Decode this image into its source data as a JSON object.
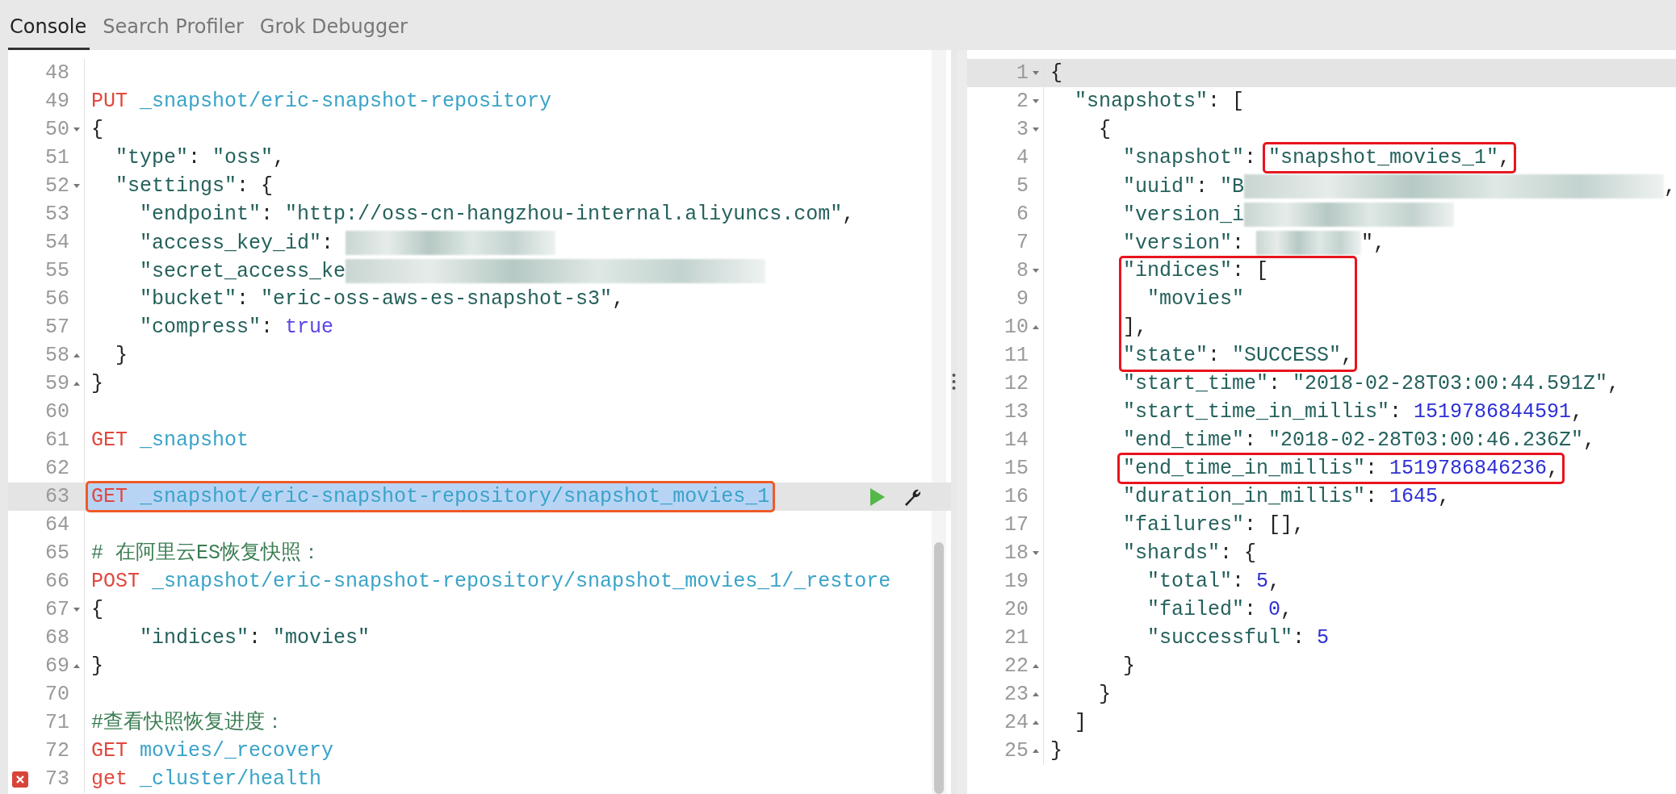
{
  "tabs": [
    {
      "label": "Console",
      "selected": true
    },
    {
      "label": "Search Profiler",
      "selected": false
    },
    {
      "label": "Grok Debugger",
      "selected": false
    }
  ],
  "request_editor": {
    "lines": [
      {
        "number": "48",
        "kind": "plain",
        "current": false,
        "selected": false,
        "error": false
      },
      {
        "number": "49",
        "kind": "plain",
        "current": false,
        "selected": false,
        "error": false,
        "tokens": [
          {
            "text": "PUT",
            "kind": "method"
          },
          {
            "text": " _snapshot/eric-snapshot-repository",
            "kind": "path"
          }
        ]
      },
      {
        "number": "50",
        "kind": "foldstart",
        "current": false,
        "selected": false,
        "error": false,
        "tokens": [
          {
            "text": "{",
            "kind": "punct"
          }
        ]
      },
      {
        "number": "51",
        "kind": "plain",
        "current": false,
        "selected": false,
        "error": false,
        "tokens": [
          {
            "text": "  \"type\"",
            "kind": "key"
          },
          {
            "text": ": ",
            "kind": "punct"
          },
          {
            "text": "\"oss\"",
            "kind": "string"
          },
          {
            "text": ",",
            "kind": "punct"
          }
        ]
      },
      {
        "number": "52",
        "kind": "foldstart",
        "current": false,
        "selected": false,
        "error": false,
        "tokens": [
          {
            "text": "  \"settings\"",
            "kind": "key"
          },
          {
            "text": ": {",
            "kind": "punct"
          }
        ]
      },
      {
        "number": "53",
        "kind": "plain",
        "current": false,
        "selected": false,
        "error": false,
        "tokens": [
          {
            "text": "    \"endpoint\"",
            "kind": "key"
          },
          {
            "text": ": ",
            "kind": "punct"
          },
          {
            "text": "\"http://oss-cn-hangzhou-internal.aliyuncs.com\"",
            "kind": "string"
          },
          {
            "text": ",",
            "kind": "punct"
          }
        ]
      },
      {
        "number": "54",
        "kind": "plain",
        "current": false,
        "selected": false,
        "error": false,
        "tokens": [
          {
            "text": "    \"access_key_id\"",
            "kind": "key"
          },
          {
            "text": ": ",
            "kind": "punct"
          },
          {
            "kind": "blurmedium"
          }
        ]
      },
      {
        "number": "55",
        "kind": "plain",
        "current": false,
        "selected": false,
        "error": false,
        "tokens": [
          {
            "text": "    \"secret_access_ke",
            "kind": "key"
          },
          {
            "kind": "blurlong"
          }
        ]
      },
      {
        "number": "56",
        "kind": "plain",
        "current": false,
        "selected": false,
        "error": false,
        "tokens": [
          {
            "text": "    \"bucket\"",
            "kind": "key"
          },
          {
            "text": ": ",
            "kind": "punct"
          },
          {
            "text": "\"eric-oss-aws-es-snapshot-s3\"",
            "kind": "string"
          },
          {
            "text": ",",
            "kind": "punct"
          }
        ]
      },
      {
        "number": "57",
        "kind": "plain",
        "current": false,
        "selected": false,
        "error": false,
        "tokens": [
          {
            "text": "    \"compress\"",
            "kind": "key"
          },
          {
            "text": ": ",
            "kind": "punct"
          },
          {
            "text": "true",
            "kind": "bool"
          }
        ]
      },
      {
        "number": "58",
        "kind": "foldend",
        "current": false,
        "selected": false,
        "error": false,
        "tokens": [
          {
            "text": "  }",
            "kind": "punct"
          }
        ]
      },
      {
        "number": "59",
        "kind": "foldend",
        "current": false,
        "selected": false,
        "error": false,
        "tokens": [
          {
            "text": "}",
            "kind": "punct"
          }
        ]
      },
      {
        "number": "60",
        "kind": "plain",
        "current": false,
        "selected": false,
        "error": false
      },
      {
        "number": "61",
        "kind": "plain",
        "current": false,
        "selected": false,
        "error": false,
        "tokens": [
          {
            "text": "GET",
            "kind": "method"
          },
          {
            "text": " _snapshot",
            "kind": "path"
          }
        ]
      },
      {
        "number": "62",
        "kind": "plain",
        "current": false,
        "selected": false,
        "error": false
      },
      {
        "number": "63",
        "kind": "plain",
        "current": true,
        "selected": true,
        "error": false,
        "boxed_tokens": [
          {
            "text": "GET",
            "kind": "method"
          },
          {
            "text": " _snapshot/eric-snapshot-repository/snapshot_movies_1",
            "kind": "path"
          }
        ]
      },
      {
        "number": "64",
        "kind": "plain",
        "current": false,
        "selected": false,
        "error": false
      },
      {
        "number": "65",
        "kind": "plain",
        "current": false,
        "selected": false,
        "error": false,
        "tokens": [
          {
            "text": "# 在阿里云ES恢复快照：",
            "kind": "comment"
          }
        ]
      },
      {
        "number": "66",
        "kind": "plain",
        "current": false,
        "selected": false,
        "error": false,
        "tokens": [
          {
            "text": "POST",
            "kind": "method"
          },
          {
            "text": " _snapshot/eric-snapshot-repository/snapshot_movies_1/_restore",
            "kind": "path"
          }
        ]
      },
      {
        "number": "67",
        "kind": "foldstart",
        "current": false,
        "selected": false,
        "error": false,
        "tokens": [
          {
            "text": "{",
            "kind": "punct"
          }
        ]
      },
      {
        "number": "68",
        "kind": "plain",
        "current": false,
        "selected": false,
        "error": false,
        "tokens": [
          {
            "text": "    \"indices\"",
            "kind": "key"
          },
          {
            "text": ": ",
            "kind": "punct"
          },
          {
            "text": "\"movies\"",
            "kind": "string"
          }
        ]
      },
      {
        "number": "69",
        "kind": "foldend",
        "current": false,
        "selected": false,
        "error": false,
        "tokens": [
          {
            "text": "}",
            "kind": "punct"
          }
        ]
      },
      {
        "number": "70",
        "kind": "plain",
        "current": false,
        "selected": false,
        "error": false
      },
      {
        "number": "71",
        "kind": "plain",
        "current": false,
        "selected": false,
        "error": false,
        "tokens": [
          {
            "text": "#查看快照恢复进度：",
            "kind": "comment"
          }
        ]
      },
      {
        "number": "72",
        "kind": "plain",
        "current": false,
        "selected": false,
        "error": false,
        "tokens": [
          {
            "text": "GET",
            "kind": "method"
          },
          {
            "text": " movies/_recovery",
            "kind": "path"
          }
        ]
      },
      {
        "number": "73",
        "kind": "plain",
        "current": false,
        "selected": false,
        "error": true,
        "tokens": [
          {
            "text": "get",
            "kind": "method"
          },
          {
            "text": " _cluster/health",
            "kind": "path"
          }
        ]
      }
    ]
  },
  "response_viewer": {
    "lines": [
      {
        "number": "1",
        "kind": "foldstart",
        "current": true,
        "selected": false,
        "error": false,
        "tokens": [
          {
            "text": "{",
            "kind": "punct"
          }
        ]
      },
      {
        "number": "2",
        "kind": "foldstart",
        "current": false,
        "selected": false,
        "error": false,
        "tokens": [
          {
            "text": "  \"snapshots\"",
            "kind": "key"
          },
          {
            "text": ": [",
            "kind": "punct"
          }
        ]
      },
      {
        "number": "3",
        "kind": "foldstart",
        "current": false,
        "selected": false,
        "error": false,
        "tokens": [
          {
            "text": "    {",
            "kind": "punct"
          }
        ]
      },
      {
        "number": "4",
        "kind": "plain",
        "current": false,
        "selected": false,
        "error": false,
        "tokens": [
          {
            "text": "      \"snapshot\"",
            "kind": "key"
          },
          {
            "text": ": ",
            "kind": "punct"
          }
        ],
        "boxed_tokens": [
          {
            "text": "\"snapshot_movies_1\"",
            "kind": "string"
          },
          {
            "text": ",",
            "kind": "punct"
          }
        ]
      },
      {
        "number": "5",
        "kind": "plain",
        "current": false,
        "selected": false,
        "error": false,
        "tokens": [
          {
            "text": "      \"uuid\"",
            "kind": "key"
          },
          {
            "text": ": ",
            "kind": "punct"
          },
          {
            "text": "\"B",
            "kind": "string"
          },
          {
            "kind": "blurlong"
          },
          {
            "text": ",",
            "kind": "punct"
          }
        ]
      },
      {
        "number": "6",
        "kind": "plain",
        "current": false,
        "selected": false,
        "error": false,
        "tokens": [
          {
            "text": "      \"version_i",
            "kind": "key"
          },
          {
            "kind": "blurmedium"
          }
        ]
      },
      {
        "number": "7",
        "kind": "plain",
        "current": false,
        "selected": false,
        "error": false,
        "tokens": [
          {
            "text": "      \"version\"",
            "kind": "key"
          },
          {
            "text": ": ",
            "kind": "punct"
          },
          {
            "kind": "blurshort"
          },
          {
            "text": "\",",
            "kind": "punct"
          }
        ]
      },
      {
        "number": "8",
        "kind": "foldstart",
        "current": false,
        "selected": false,
        "error": false,
        "boxed_tokens": [
          {
            "text": "      \"indices\"",
            "kind": "key"
          },
          {
            "text": ": [",
            "kind": "punct"
          }
        ]
      },
      {
        "number": "9",
        "kind": "plain",
        "current": false,
        "selected": false,
        "error": false,
        "boxed_tokens": [
          {
            "text": "        \"movies\"",
            "kind": "string"
          }
        ]
      },
      {
        "number": "10",
        "kind": "foldend",
        "current": false,
        "selected": false,
        "error": false,
        "boxed_tokens": [
          {
            "text": "      ],",
            "kind": "punct"
          }
        ]
      },
      {
        "number": "11",
        "kind": "plain",
        "current": false,
        "selected": false,
        "error": false,
        "boxed_tokens": [
          {
            "text": "      \"state\"",
            "kind": "key"
          },
          {
            "text": ": ",
            "kind": "punct"
          },
          {
            "text": "\"SUCCESS\"",
            "kind": "string"
          },
          {
            "text": ",",
            "kind": "punct"
          }
        ]
      },
      {
        "number": "12",
        "kind": "plain",
        "current": false,
        "selected": false,
        "error": false,
        "tokens": [
          {
            "text": "      \"start_time\"",
            "kind": "key"
          },
          {
            "text": ": ",
            "kind": "punct"
          },
          {
            "text": "\"2018-02-28T03:00:44.591Z\"",
            "kind": "string"
          },
          {
            "text": ",",
            "kind": "punct"
          }
        ]
      },
      {
        "number": "13",
        "kind": "plain",
        "current": false,
        "selected": false,
        "error": false,
        "tokens": [
          {
            "text": "      \"start_time_in_millis\"",
            "kind": "key"
          },
          {
            "text": ": ",
            "kind": "punct"
          },
          {
            "text": "1519786844591",
            "kind": "number"
          },
          {
            "text": ",",
            "kind": "punct"
          }
        ]
      },
      {
        "number": "14",
        "kind": "plain",
        "current": false,
        "selected": false,
        "error": false,
        "tokens": [
          {
            "text": "      \"end_time\"",
            "kind": "key"
          },
          {
            "text": ": ",
            "kind": "punct"
          },
          {
            "text": "\"2018-02-28T03:00:46.236Z\"",
            "kind": "string"
          },
          {
            "text": ",",
            "kind": "punct"
          }
        ]
      },
      {
        "number": "15",
        "kind": "plain",
        "current": false,
        "selected": false,
        "error": false,
        "boxed_tokens": [
          {
            "text": "      \"end_time_in_millis\"",
            "kind": "key"
          },
          {
            "text": ": ",
            "kind": "punct"
          },
          {
            "text": "1519786846236",
            "kind": "number"
          },
          {
            "text": ",",
            "kind": "punct"
          }
        ]
      },
      {
        "number": "16",
        "kind": "plain",
        "current": false,
        "selected": false,
        "error": false,
        "tokens": [
          {
            "text": "      \"duration_in_millis\"",
            "kind": "key"
          },
          {
            "text": ": ",
            "kind": "punct"
          },
          {
            "text": "1645",
            "kind": "number"
          },
          {
            "text": ",",
            "kind": "punct"
          }
        ]
      },
      {
        "number": "17",
        "kind": "plain",
        "current": false,
        "selected": false,
        "error": false,
        "tokens": [
          {
            "text": "      \"failures\"",
            "kind": "key"
          },
          {
            "text": ": [],",
            "kind": "punct"
          }
        ]
      },
      {
        "number": "18",
        "kind": "foldstart",
        "current": false,
        "selected": false,
        "error": false,
        "tokens": [
          {
            "text": "      \"shards\"",
            "kind": "key"
          },
          {
            "text": ": {",
            "kind": "punct"
          }
        ]
      },
      {
        "number": "19",
        "kind": "plain",
        "current": false,
        "selected": false,
        "error": false,
        "tokens": [
          {
            "text": "        \"total\"",
            "kind": "key"
          },
          {
            "text": ": ",
            "kind": "punct"
          },
          {
            "text": "5",
            "kind": "number"
          },
          {
            "text": ",",
            "kind": "punct"
          }
        ]
      },
      {
        "number": "20",
        "kind": "plain",
        "current": false,
        "selected": false,
        "error": false,
        "tokens": [
          {
            "text": "        \"failed\"",
            "kind": "key"
          },
          {
            "text": ": ",
            "kind": "punct"
          },
          {
            "text": "0",
            "kind": "number"
          },
          {
            "text": ",",
            "kind": "punct"
          }
        ]
      },
      {
        "number": "21",
        "kind": "plain",
        "current": false,
        "selected": false,
        "error": false,
        "tokens": [
          {
            "text": "        \"successful\"",
            "kind": "key"
          },
          {
            "text": ": ",
            "kind": "punct"
          },
          {
            "text": "5",
            "kind": "number"
          }
        ]
      },
      {
        "number": "22",
        "kind": "foldend",
        "current": false,
        "selected": false,
        "error": false,
        "tokens": [
          {
            "text": "      }",
            "kind": "punct"
          }
        ]
      },
      {
        "number": "23",
        "kind": "foldend",
        "current": false,
        "selected": false,
        "error": false,
        "tokens": [
          {
            "text": "    }",
            "kind": "punct"
          }
        ]
      },
      {
        "number": "24",
        "kind": "foldend",
        "current": false,
        "selected": false,
        "error": false,
        "tokens": [
          {
            "text": "  ]",
            "kind": "punct"
          }
        ]
      },
      {
        "number": "25",
        "kind": "foldend",
        "current": false,
        "selected": false,
        "error": false,
        "tokens": [
          {
            "text": "}",
            "kind": "punct"
          }
        ]
      }
    ]
  }
}
